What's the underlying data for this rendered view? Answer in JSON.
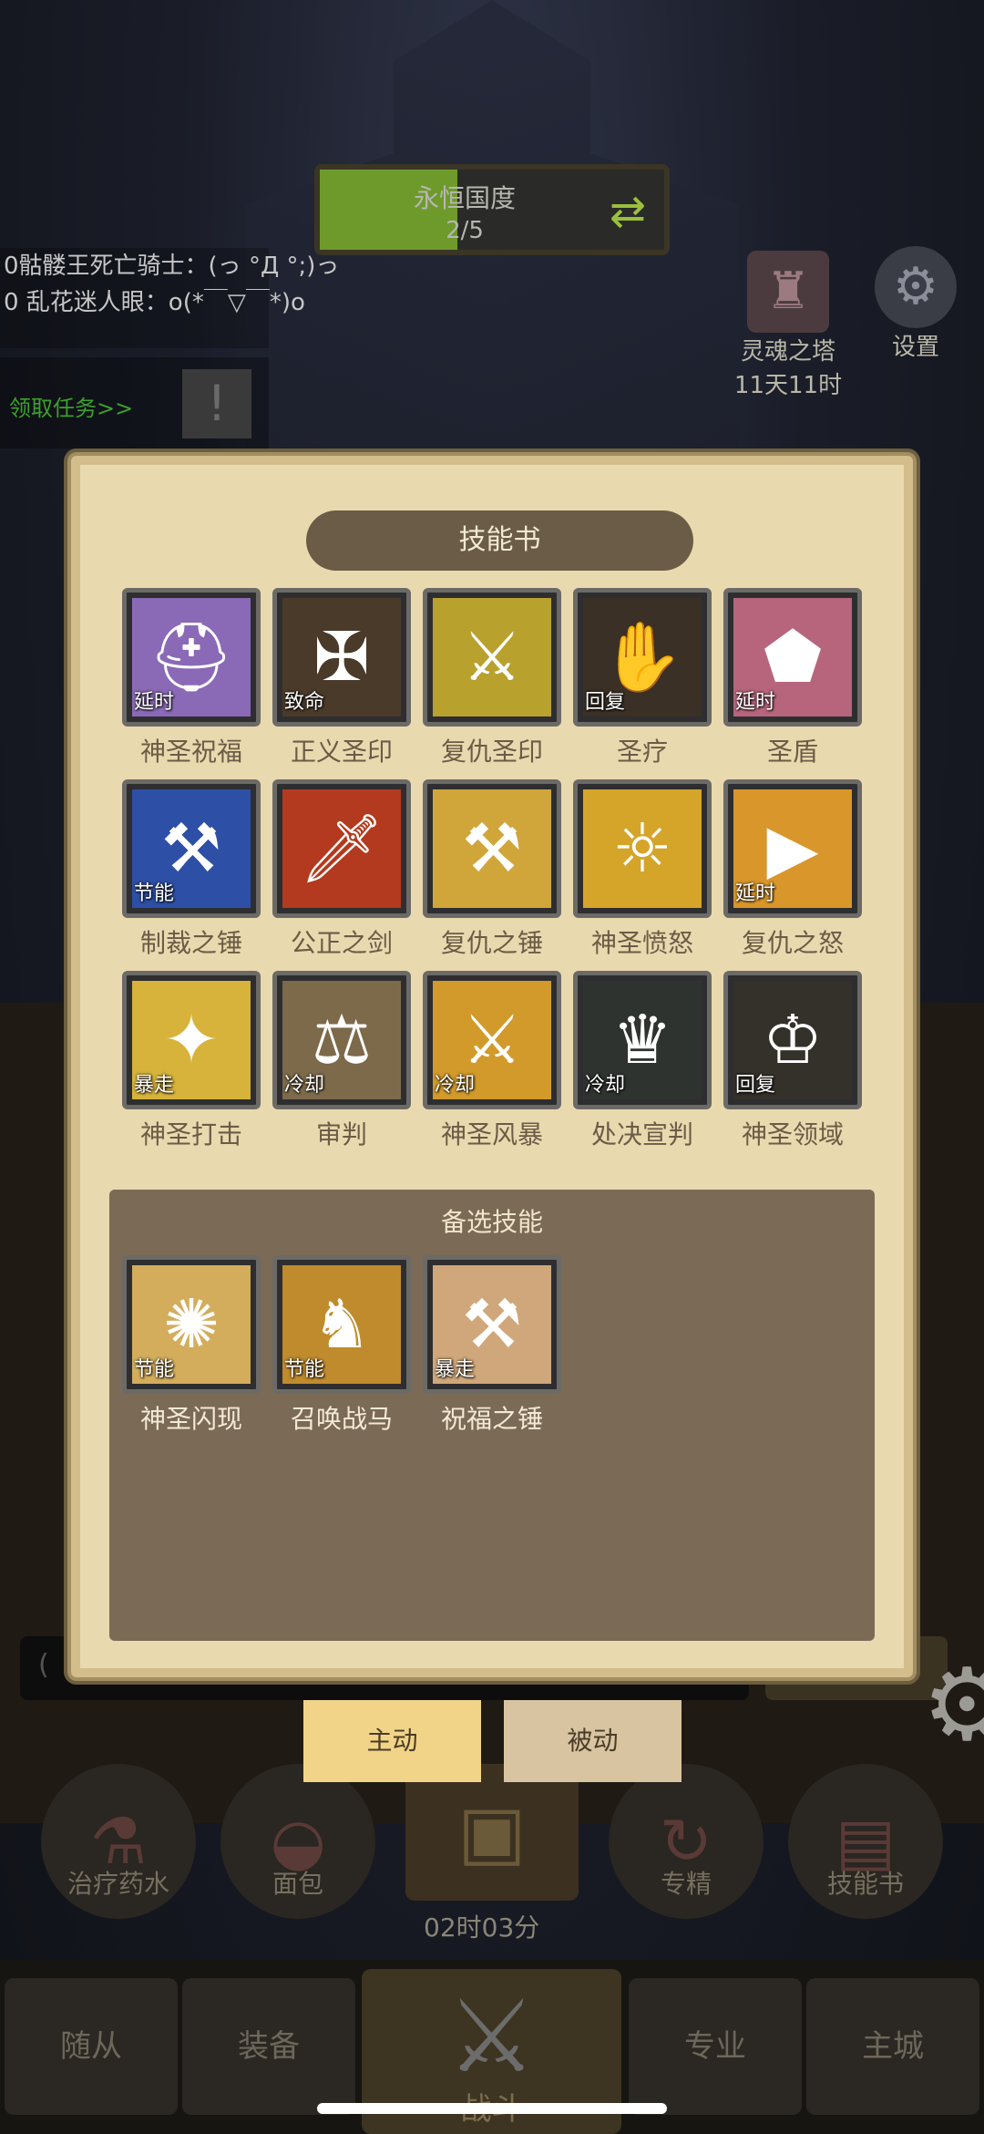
{
  "background": {
    "realm": {
      "name": "永恒国度",
      "progress": "2/5",
      "progress_fraction": 0.4
    },
    "chat": [
      "0骷髅王死亡骑士：(っ °Д °;)っ",
      "0 乱花迷人眼：o(*￣▽￣*)o"
    ],
    "task_link": "领取任务>>",
    "tower": {
      "name": "灵魂之塔",
      "time": "11天11时"
    },
    "settings_label": "设置",
    "input_placeholder": "(",
    "tools": [
      "治疗药水",
      "面包",
      "专精",
      "技能书"
    ],
    "timer": "02时03分",
    "nav": [
      "随从",
      "装备",
      "战斗",
      "专业",
      "主城"
    ]
  },
  "panel": {
    "title": "技能书",
    "skills": [
      {
        "name": "神圣祝福",
        "tag": "延时",
        "icon": "golden-helmet-icon",
        "bg": "#8a6ab6"
      },
      {
        "name": "正义圣印",
        "tag": "致命",
        "icon": "golden-seal-icon",
        "bg": "#4a3a2a"
      },
      {
        "name": "复仇圣印",
        "tag": "",
        "icon": "crossed-swords-icon",
        "bg": "#b9a12e"
      },
      {
        "name": "圣疗",
        "tag": "回复",
        "icon": "healing-hand-icon",
        "bg": "#3a3026"
      },
      {
        "name": "圣盾",
        "tag": "延时",
        "icon": "holy-shield-icon",
        "bg": "#b7657d"
      },
      {
        "name": "制裁之锤",
        "tag": "节能",
        "icon": "hammer-of-justice-icon",
        "bg": "#2d4fa6"
      },
      {
        "name": "公正之剑",
        "tag": "",
        "icon": "flaming-sword-icon",
        "bg": "#b33a1e"
      },
      {
        "name": "复仇之锤",
        "tag": "",
        "icon": "golden-hammer-icon",
        "bg": "#d0a63a"
      },
      {
        "name": "神圣愤怒",
        "tag": "",
        "icon": "light-beam-icon",
        "bg": "#d5a52a"
      },
      {
        "name": "复仇之怒",
        "tag": "延时",
        "icon": "avenging-wrath-icon",
        "bg": "#d9962a"
      },
      {
        "name": "神圣打击",
        "tag": "暴走",
        "icon": "holy-strike-icon",
        "bg": "#d7b33b"
      },
      {
        "name": "审判",
        "tag": "冷却",
        "icon": "judgement-icon",
        "bg": "#7d6a4a"
      },
      {
        "name": "神圣风暴",
        "tag": "冷却",
        "icon": "divine-storm-icon",
        "bg": "#d29a2a"
      },
      {
        "name": "处决宣判",
        "tag": "冷却",
        "icon": "execution-icon",
        "bg": "#2f3330"
      },
      {
        "name": "神圣领域",
        "tag": "回复",
        "icon": "holy-crown-icon",
        "bg": "#34302a"
      }
    ],
    "alt_title": "备选技能",
    "alt_skills": [
      {
        "name": "神圣闪现",
        "tag": "节能",
        "icon": "holy-flash-icon",
        "bg": "#d3ad5c"
      },
      {
        "name": "召唤战马",
        "tag": "节能",
        "icon": "war-horse-icon",
        "bg": "#c08b2d"
      },
      {
        "name": "祝福之锤",
        "tag": "暴走",
        "icon": "blessed-hammer-icon",
        "bg": "#d0a77a"
      }
    ]
  },
  "tabs": {
    "active": "主动",
    "inactive": "被动"
  }
}
